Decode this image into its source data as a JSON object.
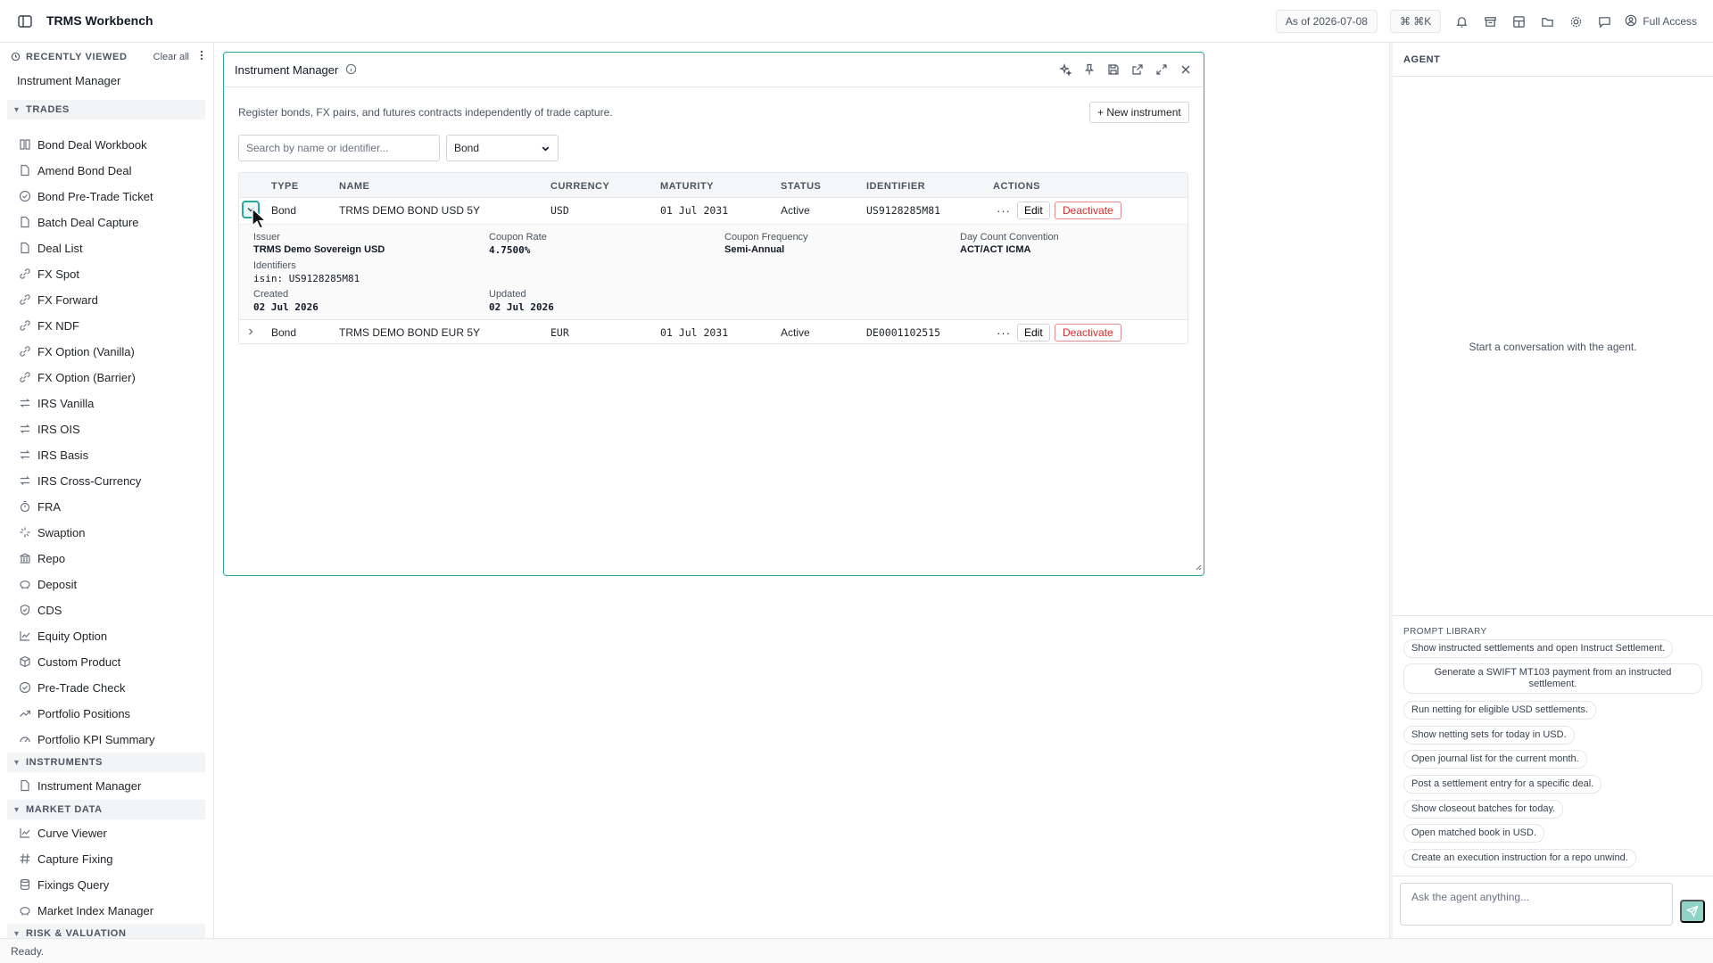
{
  "app": {
    "title": "TRMS Workbench"
  },
  "topbar": {
    "as_of": "As of 2026-07-08",
    "shortcut": "⌘ ⌘K",
    "access": "Full Access"
  },
  "sidebar": {
    "recent_label": "RECENTLY VIEWED",
    "clear_all": "Clear all",
    "recent_items": [
      "Instrument Manager"
    ],
    "sections": [
      {
        "title": "TRADES",
        "items": [
          "Bond Deal Workbook",
          "Amend Bond Deal",
          "Bond Pre-Trade Ticket",
          "Batch Deal Capture",
          "Deal List",
          "FX Spot",
          "FX Forward",
          "FX NDF",
          "FX Option (Vanilla)",
          "FX Option (Barrier)",
          "IRS Vanilla",
          "IRS OIS",
          "IRS Basis",
          "IRS Cross-Currency",
          "FRA",
          "Swaption",
          "Repo",
          "Deposit",
          "CDS",
          "Equity Option",
          "Custom Product",
          "Pre-Trade Check",
          "Portfolio Positions",
          "Portfolio KPI Summary"
        ]
      },
      {
        "title": "INSTRUMENTS",
        "items": [
          "Instrument Manager"
        ]
      },
      {
        "title": "MARKET DATA",
        "items": [
          "Curve Viewer",
          "Capture Fixing",
          "Fixings Query",
          "Market Index Manager"
        ]
      },
      {
        "title": "RISK & VALUATION",
        "items": []
      }
    ]
  },
  "panel": {
    "title": "Instrument Manager",
    "description": "Register bonds, FX pairs, and futures contracts independently of trade capture.",
    "new_button": "+ New instrument",
    "search_placeholder": "Search by name or identifier...",
    "type_filter": "Bond",
    "columns": [
      "TYPE",
      "NAME",
      "CURRENCY",
      "MATURITY",
      "STATUS",
      "IDENTIFIER",
      "ACTIONS"
    ],
    "rows": [
      {
        "type": "Bond",
        "name": "TRMS DEMO BOND USD 5Y",
        "currency": "USD",
        "maturity": "01 Jul 2031",
        "status": "Active",
        "identifier": "US9128285M81",
        "more": "···",
        "edit": "Edit",
        "deactivate": "Deactivate"
      },
      {
        "type": "Bond",
        "name": "TRMS DEMO BOND EUR 5Y",
        "currency": "EUR",
        "maturity": "01 Jul 2031",
        "status": "Active",
        "identifier": "DE0001102515",
        "more": "···",
        "edit": "Edit",
        "deactivate": "Deactivate"
      }
    ],
    "detail": {
      "issuer_label": "Issuer",
      "issuer": "TRMS Demo Sovereign USD",
      "coupon_rate_label": "Coupon Rate",
      "coupon_rate": "4.7500%",
      "coupon_freq_label": "Coupon Frequency",
      "coupon_freq": "Semi-Annual",
      "day_count_label": "Day Count Convention",
      "day_count": "ACT/ACT ICMA",
      "identifiers_label": "Identifiers",
      "identifiers": "isin: US9128285M81",
      "created_label": "Created",
      "created": "02 Jul 2026",
      "updated_label": "Updated",
      "updated": "02 Jul 2026"
    }
  },
  "agent": {
    "header": "AGENT",
    "empty": "Start a conversation with the agent.",
    "library_label": "PROMPT LIBRARY",
    "prompts": [
      "Show instructed settlements and open Instruct Settlement.",
      "Generate a SWIFT MT103 payment from an instructed settlement.",
      "Run netting for eligible USD settlements.",
      "Show netting sets for today in USD.",
      "Open journal list for the current month.",
      "Post a settlement entry for a specific deal.",
      "Show closeout batches for today.",
      "Open matched book in USD.",
      "Create an execution instruction for a repo unwind."
    ],
    "input_placeholder": "Ask the agent anything..."
  },
  "status": {
    "text": "Ready."
  },
  "colors": {
    "accent": "#2aa89e",
    "danger": "#d92d2d"
  }
}
